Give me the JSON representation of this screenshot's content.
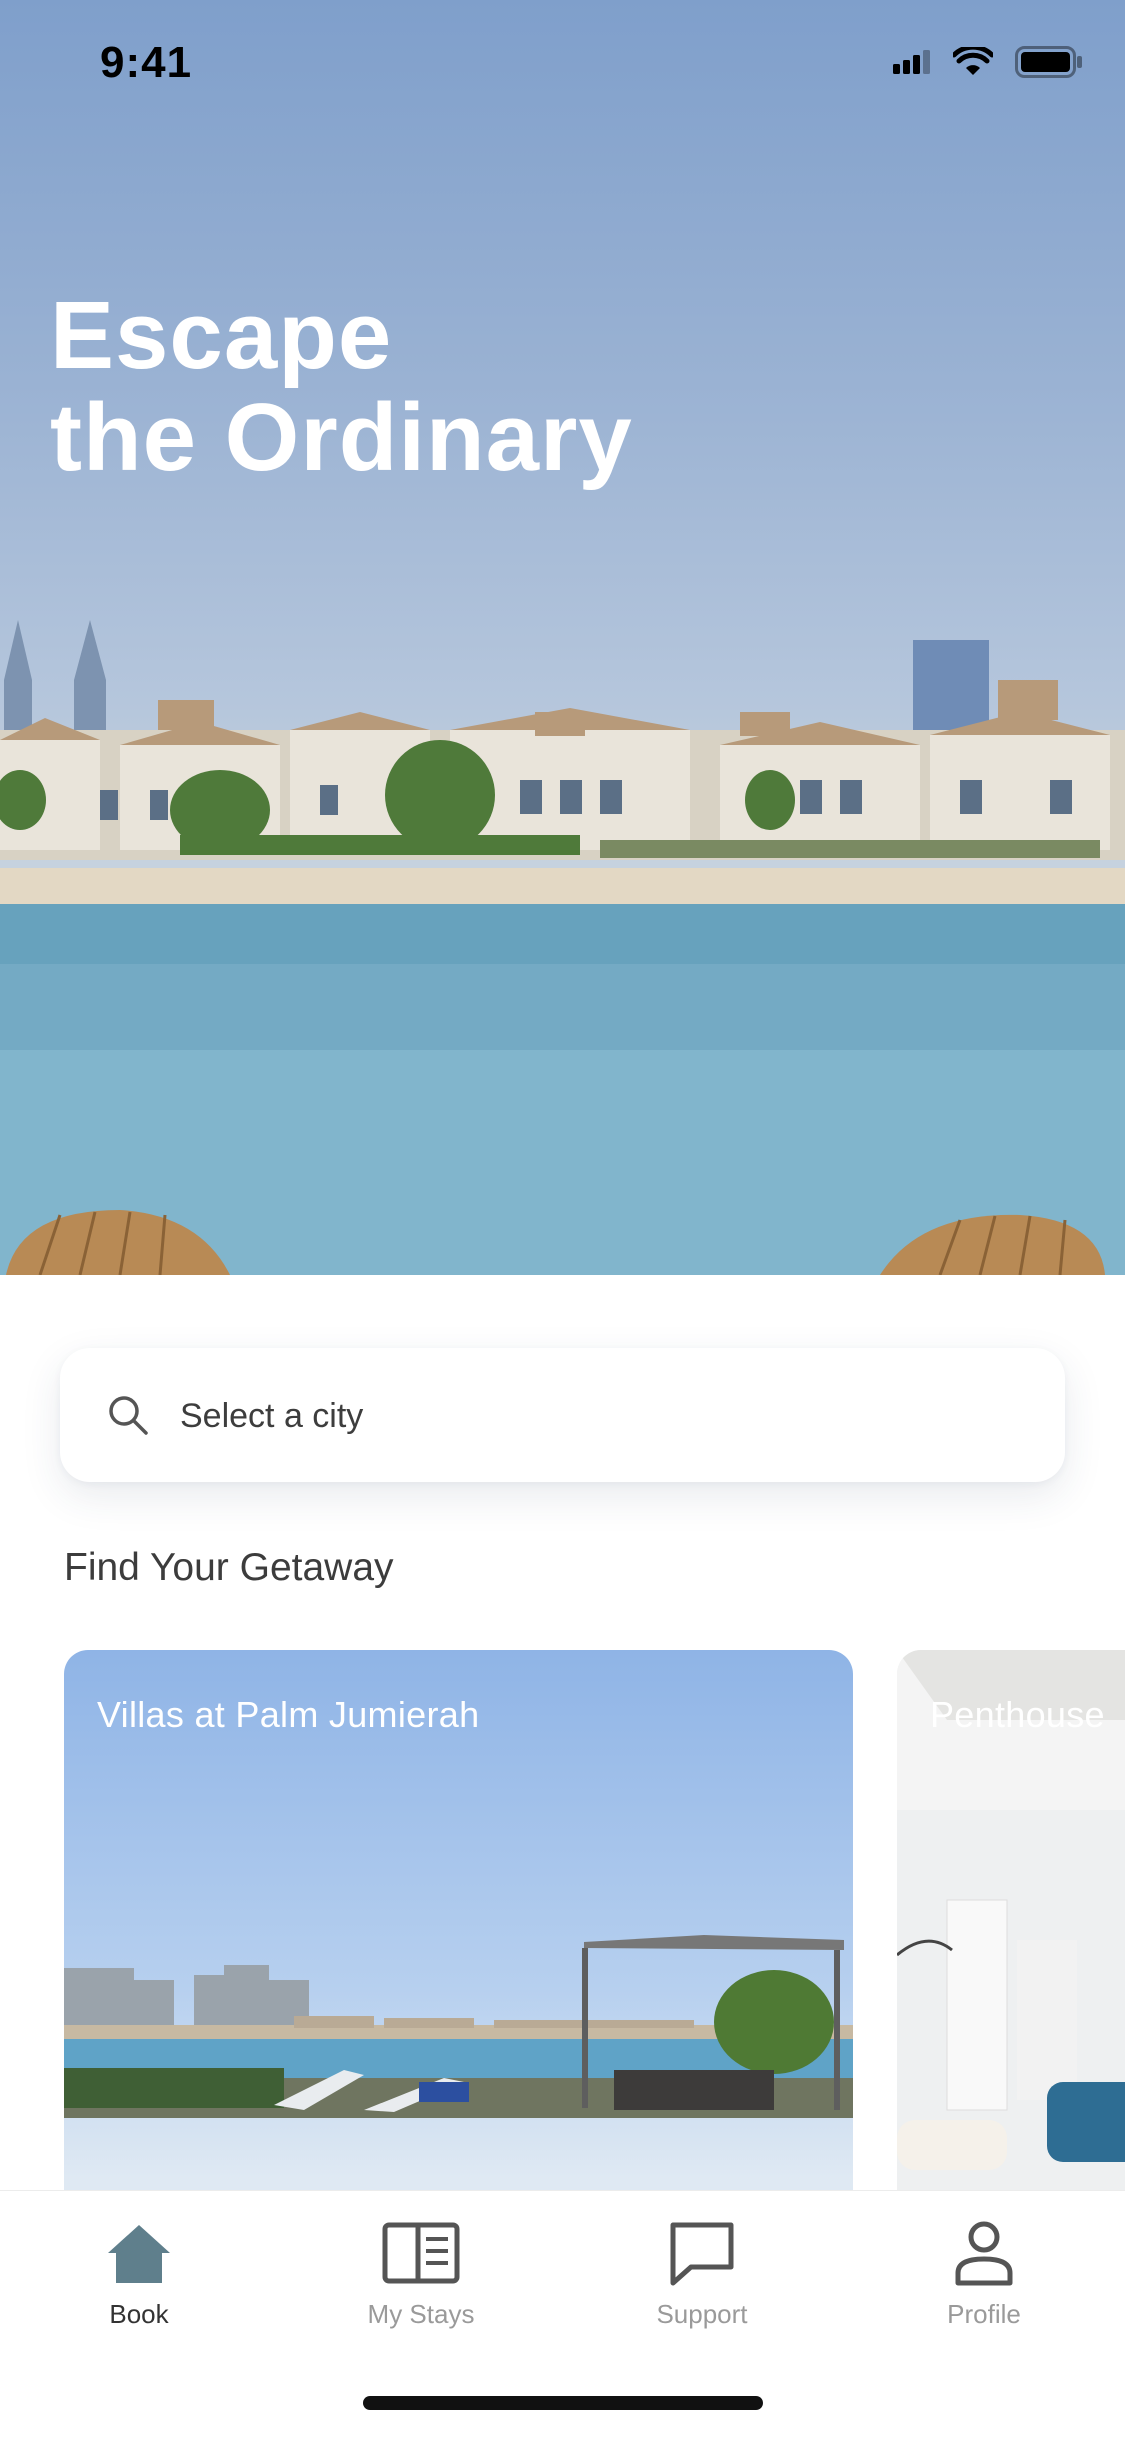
{
  "status_bar": {
    "time": "9:41"
  },
  "hero": {
    "title": "Escape\nthe Ordinary"
  },
  "search": {
    "placeholder": "Select a city"
  },
  "section": {
    "title": "Find Your Getaway"
  },
  "cards": [
    {
      "title": "Villas at Palm Jumierah"
    },
    {
      "title": "Penthouse"
    }
  ],
  "tabs": [
    {
      "label": "Book",
      "icon": "home-icon",
      "active": true
    },
    {
      "label": "My Stays",
      "icon": "book-icon",
      "active": false
    },
    {
      "label": "Support",
      "icon": "chat-bubble-icon",
      "active": false
    },
    {
      "label": "Profile",
      "icon": "person-icon",
      "active": false
    }
  ],
  "colors": {
    "active_tab_icon": "#5f7f8c",
    "inactive_tab_icon": "#555555",
    "inactive_tab_label": "#9a9a9a"
  }
}
